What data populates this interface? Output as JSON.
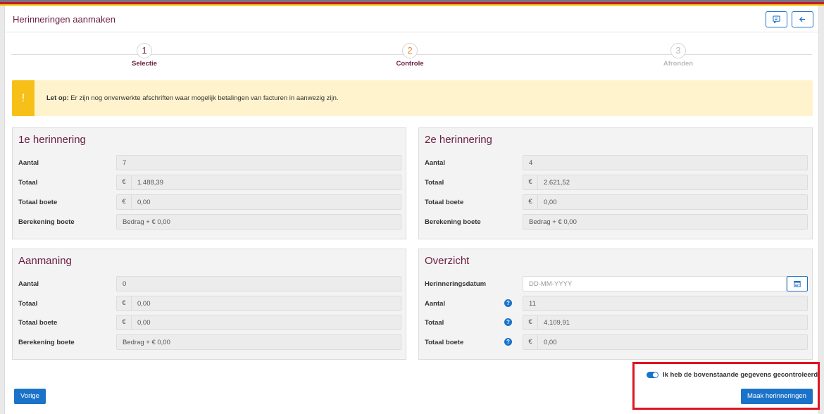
{
  "header": {
    "title": "Herinneringen aanmaken",
    "comment_button": "comment-icon",
    "back_button": "arrow-left-icon"
  },
  "steps": [
    {
      "num": "1",
      "label": "Selectie",
      "state": "done"
    },
    {
      "num": "2",
      "label": "Controle",
      "state": "active"
    },
    {
      "num": "3",
      "label": "Afronden",
      "state": "disabled"
    }
  ],
  "alert": {
    "strong": "Let op:",
    "text": " Er zijn nog onverwerkte afschriften waar mogelijk betalingen van facturen in aanwezig zijn.",
    "icon": "!"
  },
  "currency": "€",
  "panels": {
    "first": {
      "title": "1e herinnering",
      "aantal_label": "Aantal",
      "aantal": "7",
      "totaal_label": "Totaal",
      "totaal": "1.488,39",
      "boete_label": "Totaal boete",
      "boete": "0,00",
      "berekening_label": "Berekening boete",
      "berekening": "Bedrag + € 0,00"
    },
    "second": {
      "title": "2e herinnering",
      "aantal_label": "Aantal",
      "aantal": "4",
      "totaal_label": "Totaal",
      "totaal": "2.621,52",
      "boete_label": "Totaal boete",
      "boete": "0,00",
      "berekening_label": "Berekening boete",
      "berekening": "Bedrag + € 0,00"
    },
    "aanmaning": {
      "title": "Aanmaning",
      "aantal_label": "Aantal",
      "aantal": "0",
      "totaal_label": "Totaal",
      "totaal": "0,00",
      "boete_label": "Totaal boete",
      "boete": "0,00",
      "berekening_label": "Berekening boete",
      "berekening": "Bedrag + € 0,00"
    },
    "overzicht": {
      "title": "Overzicht",
      "datum_label": "Herinneringsdatum",
      "datum_placeholder": "DD-MM-YYYY",
      "aantal_label": "Aantal",
      "aantal": "11",
      "totaal_label": "Totaal",
      "totaal": "4.109,91",
      "boete_label": "Totaal boete",
      "boete": "0,00",
      "help": "?"
    }
  },
  "footer": {
    "prev_button": "Vorige",
    "confirm_label": "Ik heb de bovenstaande gegevens gecontroleerd",
    "confirm_checked": true,
    "create_button": "Maak herinneringen"
  },
  "colors": {
    "brand": "#6b1d3f",
    "primary": "#1a73c9",
    "warning": "#f6c018",
    "highlight": "#e01522"
  }
}
